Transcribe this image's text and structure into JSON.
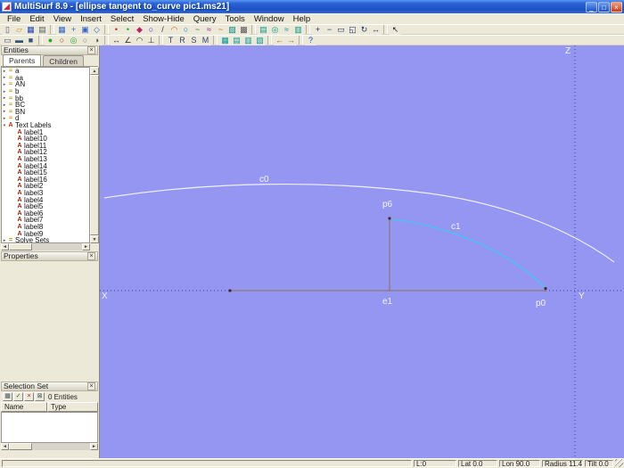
{
  "window": {
    "title": "MultiSurf 8.9 - [ellipse tangent to_curve pic1.ms21]",
    "buttons": {
      "minimize": "_",
      "maximize": "□",
      "close": "×"
    }
  },
  "menu": {
    "items": [
      {
        "label": "File",
        "name": "menu-file"
      },
      {
        "label": "Edit",
        "name": "menu-edit"
      },
      {
        "label": "View",
        "name": "menu-view"
      },
      {
        "label": "Insert",
        "name": "menu-insert"
      },
      {
        "label": "Select",
        "name": "menu-select"
      },
      {
        "label": "Show-Hide",
        "name": "menu-show-hide"
      },
      {
        "label": "Query",
        "name": "menu-query"
      },
      {
        "label": "Tools",
        "name": "menu-tools"
      },
      {
        "label": "Window",
        "name": "menu-window"
      },
      {
        "label": "Help",
        "name": "menu-help"
      }
    ]
  },
  "toolbar1": [
    {
      "name": "new-file-icon",
      "glyph": "▯",
      "color": "#555577"
    },
    {
      "name": "open-file-icon",
      "glyph": "▱",
      "color": "#cc9922"
    },
    {
      "name": "save-icon",
      "glyph": "▦",
      "color": "#2244bb"
    },
    {
      "name": "print-icon",
      "glyph": "▤",
      "color": "#556066"
    },
    {
      "sep": true
    },
    {
      "name": "grid-view-icon",
      "glyph": "▦",
      "color": "#3366cc"
    },
    {
      "name": "axes-view-icon",
      "glyph": "+",
      "color": "#3366cc"
    },
    {
      "name": "ortho-view-icon",
      "glyph": "▣",
      "color": "#3366cc"
    },
    {
      "name": "perspective-view-icon",
      "glyph": "◇",
      "color": "#3366cc"
    },
    {
      "sep": true
    },
    {
      "name": "point-entity-icon",
      "glyph": "•",
      "color": "#cc2222"
    },
    {
      "name": "bead-entity-icon",
      "glyph": "•",
      "color": "#22aa22"
    },
    {
      "name": "magnet-entity-icon",
      "glyph": "◆",
      "color": "#bb2266"
    },
    {
      "name": "ring-entity-icon",
      "glyph": "○",
      "color": "#2222cc"
    },
    {
      "name": "line-entity-icon",
      "glyph": "/",
      "color": "#333333"
    },
    {
      "name": "arc-entity-icon",
      "glyph": "◠",
      "color": "#cc6600"
    },
    {
      "name": "circle-entity-icon",
      "glyph": "○",
      "color": "#0066cc"
    },
    {
      "name": "bcurve-entity-icon",
      "glyph": "~",
      "color": "#119911"
    },
    {
      "name": "ccurve-entity-icon",
      "glyph": "≈",
      "color": "#991199"
    },
    {
      "name": "snake-entity-icon",
      "glyph": "~",
      "color": "#bb7700"
    },
    {
      "name": "surface-entity-icon",
      "glyph": "▨",
      "color": "#008888"
    },
    {
      "name": "solid-entity-icon",
      "glyph": "▩",
      "color": "#555555"
    },
    {
      "sep": true
    },
    {
      "name": "ruled-surface-icon",
      "glyph": "▤",
      "color": "#009988"
    },
    {
      "name": "revolution-surface-icon",
      "glyph": "◎",
      "color": "#009988"
    },
    {
      "name": "swept-surface-icon",
      "glyph": "≈",
      "color": "#009988"
    },
    {
      "name": "lofted-surface-icon",
      "glyph": "▥",
      "color": "#009988"
    },
    {
      "sep": true
    },
    {
      "name": "zoom-in-icon",
      "glyph": "+",
      "color": "#223366"
    },
    {
      "name": "zoom-out-icon",
      "glyph": "−",
      "color": "#223366"
    },
    {
      "name": "zoom-window-icon",
      "glyph": "▭",
      "color": "#223366"
    },
    {
      "name": "zoom-all-icon",
      "glyph": "◱",
      "color": "#223366"
    },
    {
      "name": "rotate-view-icon",
      "glyph": "↻",
      "color": "#223366"
    },
    {
      "name": "pan-view-icon",
      "glyph": "↔",
      "color": "#223366"
    },
    {
      "sep": true
    },
    {
      "name": "select-arrow-icon",
      "glyph": "↖",
      "color": "#222222"
    }
  ],
  "toolbar2": [
    {
      "name": "wireframe-display-icon",
      "glyph": "▭",
      "color": "#335577"
    },
    {
      "name": "shaded-display-icon",
      "glyph": "▬",
      "color": "#335577"
    },
    {
      "name": "render-display-icon",
      "glyph": "■",
      "color": "#335577"
    },
    {
      "sep": true
    },
    {
      "name": "show-entity-icon",
      "glyph": "●",
      "color": "#22aa22"
    },
    {
      "name": "hide-entity-icon",
      "glyph": "○",
      "color": "#bb2222"
    },
    {
      "name": "show-all-icon",
      "glyph": "◎",
      "color": "#22aa22"
    },
    {
      "name": "hide-all-icon",
      "glyph": "○",
      "color": "#777777"
    },
    {
      "name": "toggle-visibility-icon",
      "glyph": "◑",
      "color": "#555555"
    },
    {
      "sep": true
    },
    {
      "name": "measure-distance-icon",
      "glyph": "↔",
      "color": "#333333"
    },
    {
      "name": "measure-angle-icon",
      "glyph": "∠",
      "color": "#333333"
    },
    {
      "name": "measure-curvature-icon",
      "glyph": "◠",
      "color": "#333333"
    },
    {
      "name": "measure-normal-icon",
      "glyph": "⊥",
      "color": "#333333"
    },
    {
      "sep": true
    },
    {
      "name": "translate-icon",
      "glyph": "T",
      "color": "#334466"
    },
    {
      "name": "rotate-icon",
      "glyph": "R",
      "color": "#334466"
    },
    {
      "name": "scale-icon",
      "glyph": "S",
      "color": "#334466"
    },
    {
      "name": "mirror-icon",
      "glyph": "M",
      "color": "#334466"
    },
    {
      "sep": true
    },
    {
      "name": "database-icon",
      "glyph": "▦",
      "color": "#009999"
    },
    {
      "name": "export-icon",
      "glyph": "▤",
      "color": "#009999"
    },
    {
      "name": "import-icon",
      "glyph": "▥",
      "color": "#009999"
    },
    {
      "name": "report-icon",
      "glyph": "▧",
      "color": "#009999"
    },
    {
      "sep": true
    },
    {
      "name": "undo-icon",
      "glyph": "←",
      "color": "#aa6600"
    },
    {
      "name": "redo-icon",
      "glyph": "→",
      "color": "#aa6600"
    },
    {
      "sep": true
    },
    {
      "name": "help-icon",
      "glyph": "?",
      "color": "#0055aa"
    }
  ],
  "entities": {
    "title": "Entities",
    "tabs": [
      "Parents",
      "Children"
    ],
    "tree": [
      {
        "label": "a",
        "tw": "▸",
        "ic": "≈",
        "icc": "#c09000",
        "name": "tree-item-a"
      },
      {
        "label": "aa",
        "tw": "▸",
        "ic": "≈",
        "icc": "#c09000",
        "name": "tree-item-aa"
      },
      {
        "label": "AN",
        "tw": "▸",
        "ic": "≈",
        "icc": "#c09000",
        "name": "tree-item-AN"
      },
      {
        "label": "b",
        "tw": "▸",
        "ic": "≈",
        "icc": "#c09000",
        "name": "tree-item-b"
      },
      {
        "label": "bb",
        "tw": "▸",
        "ic": "≈",
        "icc": "#c09000",
        "name": "tree-item-bb"
      },
      {
        "label": "BC",
        "tw": "▸",
        "ic": "≈",
        "icc": "#c09000",
        "name": "tree-item-BC"
      },
      {
        "label": "BN",
        "tw": "▸",
        "ic": "≈",
        "icc": "#c09000",
        "name": "tree-item-BN"
      },
      {
        "label": "d",
        "tw": "▸",
        "ic": "≈",
        "icc": "#c09000",
        "name": "tree-item-d"
      },
      {
        "label": "Text Labels",
        "tw": "▾",
        "ic": "A",
        "icc": "#cc2200",
        "name": "tree-item-text-labels"
      },
      {
        "label": "label1",
        "tw": "",
        "ic": "A",
        "icc": "#992200",
        "lvl": 2,
        "name": "tree-item-label1"
      },
      {
        "label": "label10",
        "tw": "",
        "ic": "A",
        "icc": "#992200",
        "lvl": 2,
        "name": "tree-item-label10"
      },
      {
        "label": "label11",
        "tw": "",
        "ic": "A",
        "icc": "#992200",
        "lvl": 2,
        "name": "tree-item-label11"
      },
      {
        "label": "label12",
        "tw": "",
        "ic": "A",
        "icc": "#992200",
        "lvl": 2,
        "name": "tree-item-label12"
      },
      {
        "label": "label13",
        "tw": "",
        "ic": "A",
        "icc": "#992200",
        "lvl": 2,
        "name": "tree-item-label13"
      },
      {
        "label": "label14",
        "tw": "",
        "ic": "A",
        "icc": "#992200",
        "lvl": 2,
        "name": "tree-item-label14"
      },
      {
        "label": "label15",
        "tw": "",
        "ic": "A",
        "icc": "#992200",
        "lvl": 2,
        "name": "tree-item-label15"
      },
      {
        "label": "label16",
        "tw": "",
        "ic": "A",
        "icc": "#992200",
        "lvl": 2,
        "name": "tree-item-label16"
      },
      {
        "label": "label2",
        "tw": "",
        "ic": "A",
        "icc": "#992200",
        "lvl": 2,
        "name": "tree-item-label2"
      },
      {
        "label": "label3",
        "tw": "",
        "ic": "A",
        "icc": "#992200",
        "lvl": 2,
        "name": "tree-item-label3"
      },
      {
        "label": "label4",
        "tw": "",
        "ic": "A",
        "icc": "#992200",
        "lvl": 2,
        "name": "tree-item-label4"
      },
      {
        "label": "label5",
        "tw": "",
        "ic": "A",
        "icc": "#992200",
        "lvl": 2,
        "name": "tree-item-label5"
      },
      {
        "label": "label6",
        "tw": "",
        "ic": "A",
        "icc": "#992200",
        "lvl": 2,
        "name": "tree-item-label6"
      },
      {
        "label": "label7",
        "tw": "",
        "ic": "A",
        "icc": "#992200",
        "lvl": 2,
        "name": "tree-item-label7"
      },
      {
        "label": "label8",
        "tw": "",
        "ic": "A",
        "icc": "#992200",
        "lvl": 2,
        "name": "tree-item-label8"
      },
      {
        "label": "label9",
        "tw": "",
        "ic": "A",
        "icc": "#992200",
        "lvl": 2,
        "name": "tree-item-label9"
      },
      {
        "label": "Solve Sets",
        "tw": "▸",
        "ic": "=",
        "icc": "#c09000",
        "name": "tree-item-solve-sets"
      }
    ]
  },
  "properties": {
    "title": "Properties"
  },
  "selection": {
    "title": "Selection Set",
    "count": "0 Entities",
    "columns": [
      "Name",
      "Type"
    ],
    "buttons": [
      {
        "name": "selection-list-icon",
        "glyph": "▦",
        "color": "#445566"
      },
      {
        "name": "selection-add-icon",
        "glyph": "✓",
        "color": "#007700"
      },
      {
        "name": "selection-remove-icon",
        "glyph": "×",
        "color": "#bb0000"
      },
      {
        "name": "selection-clear-icon",
        "glyph": "⊠",
        "color": "#445566"
      }
    ]
  },
  "canvas": {
    "background": "#9595f2",
    "colors": {
      "axis": "#3c3c9a",
      "c0": "#eef0fa",
      "c1": "#45c6f2",
      "construction": "#8a7358",
      "point": "#3a2a14"
    },
    "labels": {
      "c0": "c0",
      "c1": "c1",
      "p6": "p6",
      "e1": "e1",
      "p0": "p0",
      "x": "X",
      "y": "Y",
      "z": "Z"
    }
  },
  "statusbar": [
    "",
    "L:0",
    "Lat 0.0",
    "Lon 90.0",
    "Radius 11.4",
    "Tilt 0.0"
  ]
}
